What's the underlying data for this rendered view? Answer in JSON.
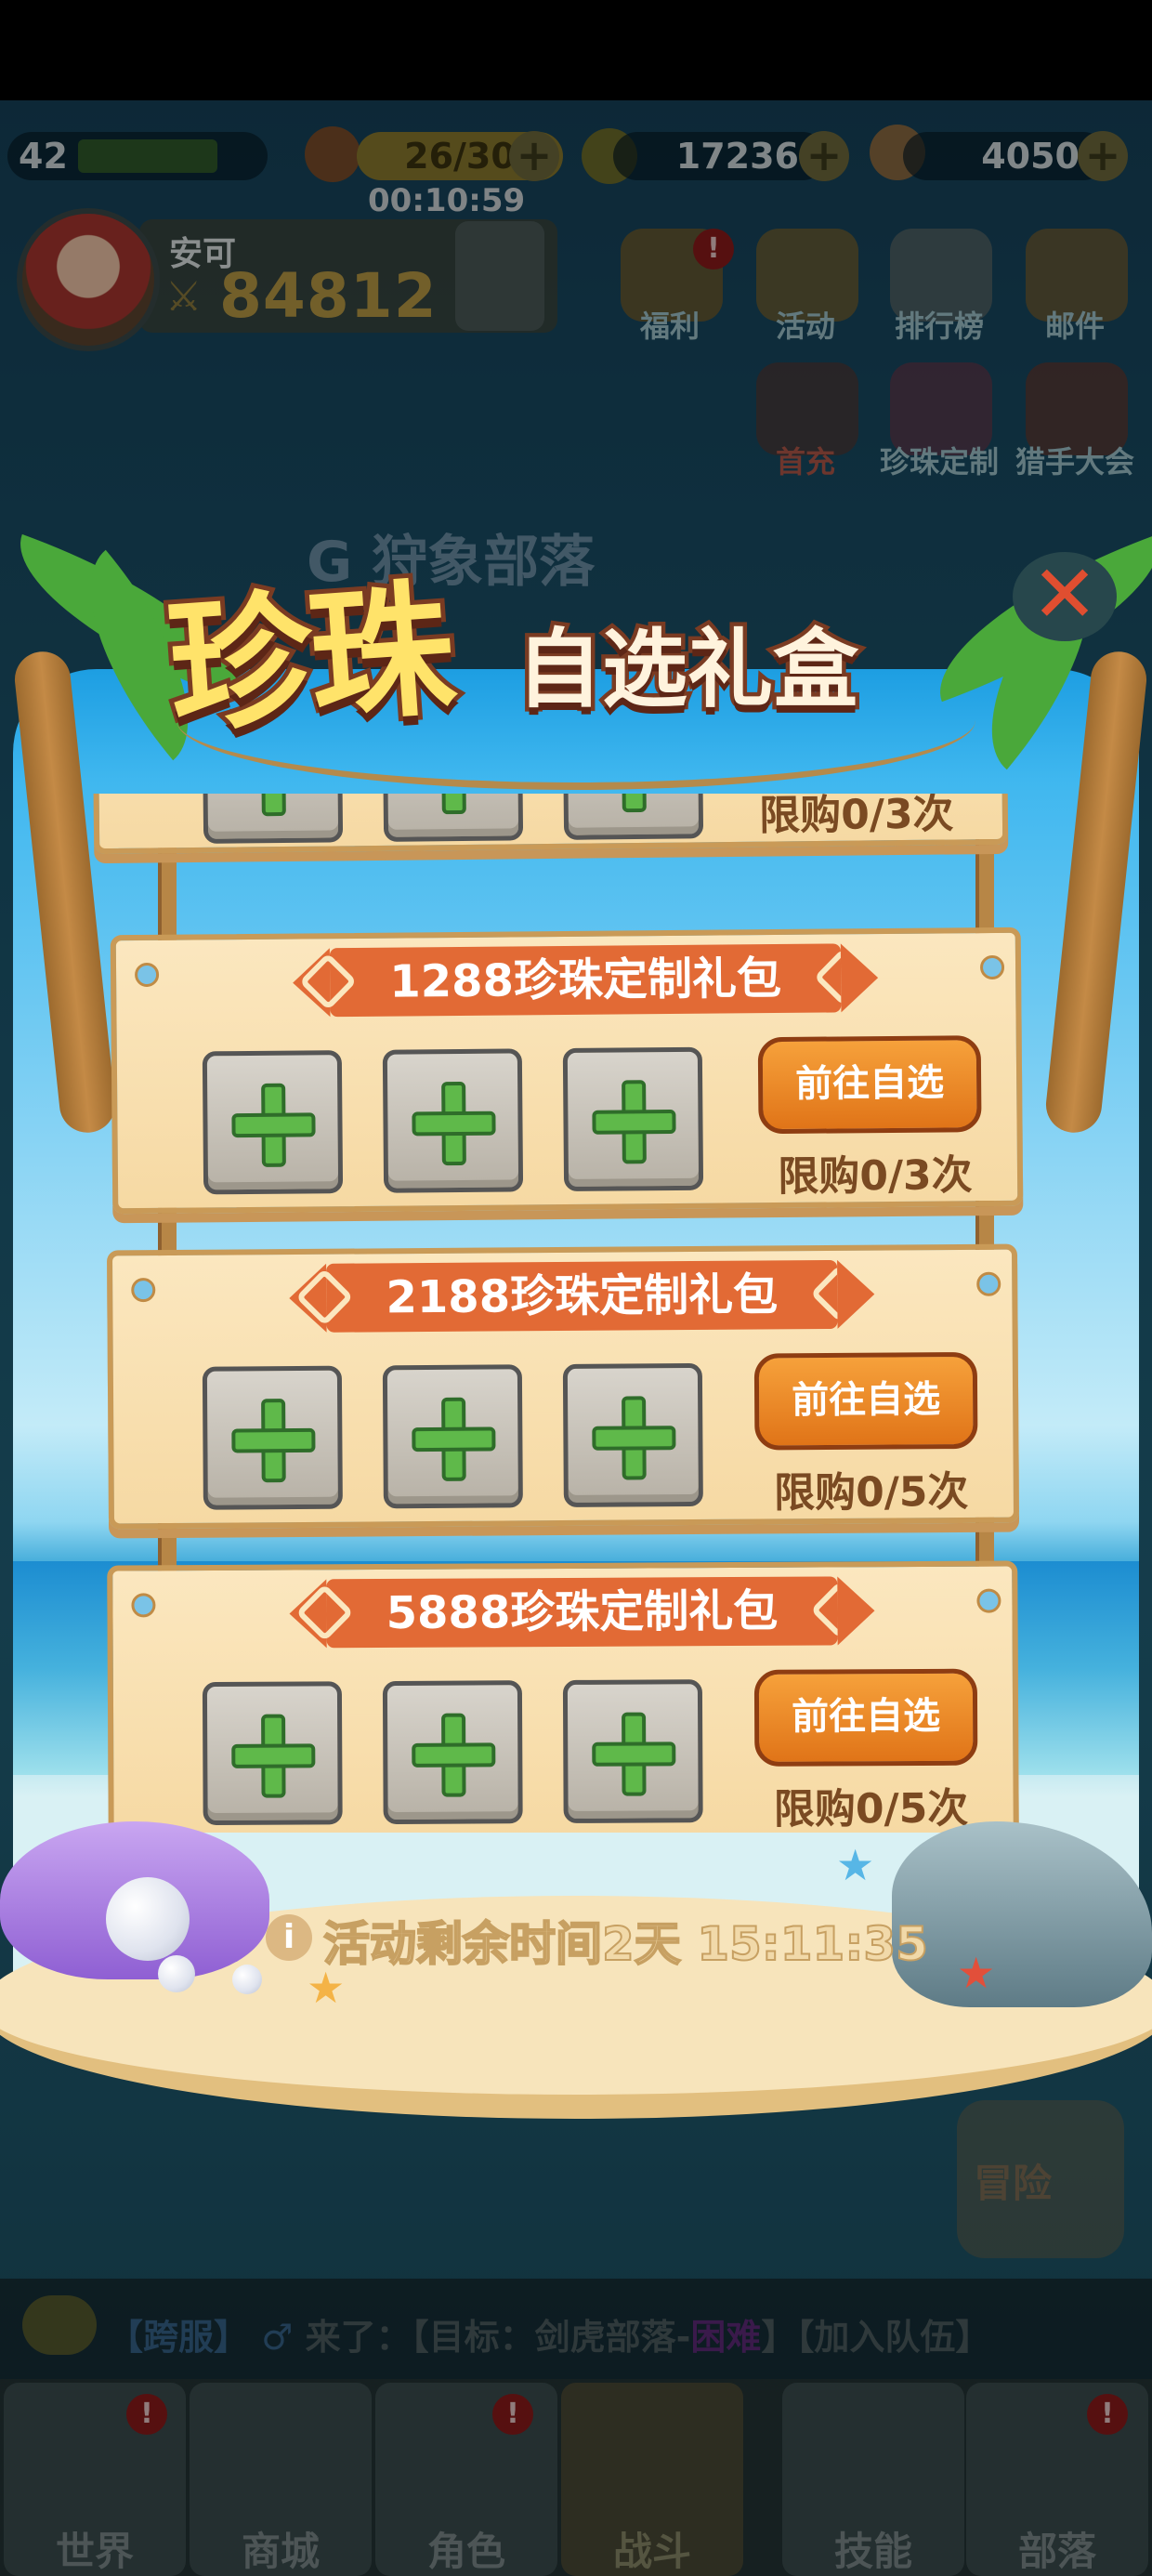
{
  "hud": {
    "level": "42",
    "energy": "26/30",
    "energy_timer": "00:10:59",
    "coins": "17236",
    "pearls": "4050",
    "plus": "+"
  },
  "player": {
    "name": "安可",
    "power": "84812"
  },
  "menu": {
    "welfare": "福利",
    "activity": "活动",
    "ranking": "排行榜",
    "mail": "邮件",
    "first_charge": "首充",
    "pearl_custom": "珍珠定制",
    "hunter_meet": "猎手大会",
    "badge": "!"
  },
  "background": {
    "tribe_title": "G 狩象部落",
    "adventure": "冒险"
  },
  "popup": {
    "title_main": "珍珠",
    "title_sub": "自选礼盒",
    "close": "✕",
    "partial_limit": "限购0/3次",
    "packs": [
      {
        "name": "1288珍珠定制礼包",
        "button": "前往自选",
        "limit": "限购0/3次"
      },
      {
        "name": "2188珍珠定制礼包",
        "button": "前往自选",
        "limit": "限购0/5次"
      },
      {
        "name": "5888珍珠定制礼包",
        "button": "前往自选",
        "limit": "限购0/5次"
      }
    ],
    "remaining": "活动剩余时间2天 15:11:35"
  },
  "chat": {
    "server": "【跨服】",
    "gender": "♂",
    "message": "来了：【目标：剑虎部落-",
    "tag": "困难",
    "join": "】【加入队伍】"
  },
  "nav": {
    "world": "世界",
    "shop": "商城",
    "character": "角色",
    "battle": "战斗",
    "skills": "技能",
    "tribe": "部落"
  }
}
